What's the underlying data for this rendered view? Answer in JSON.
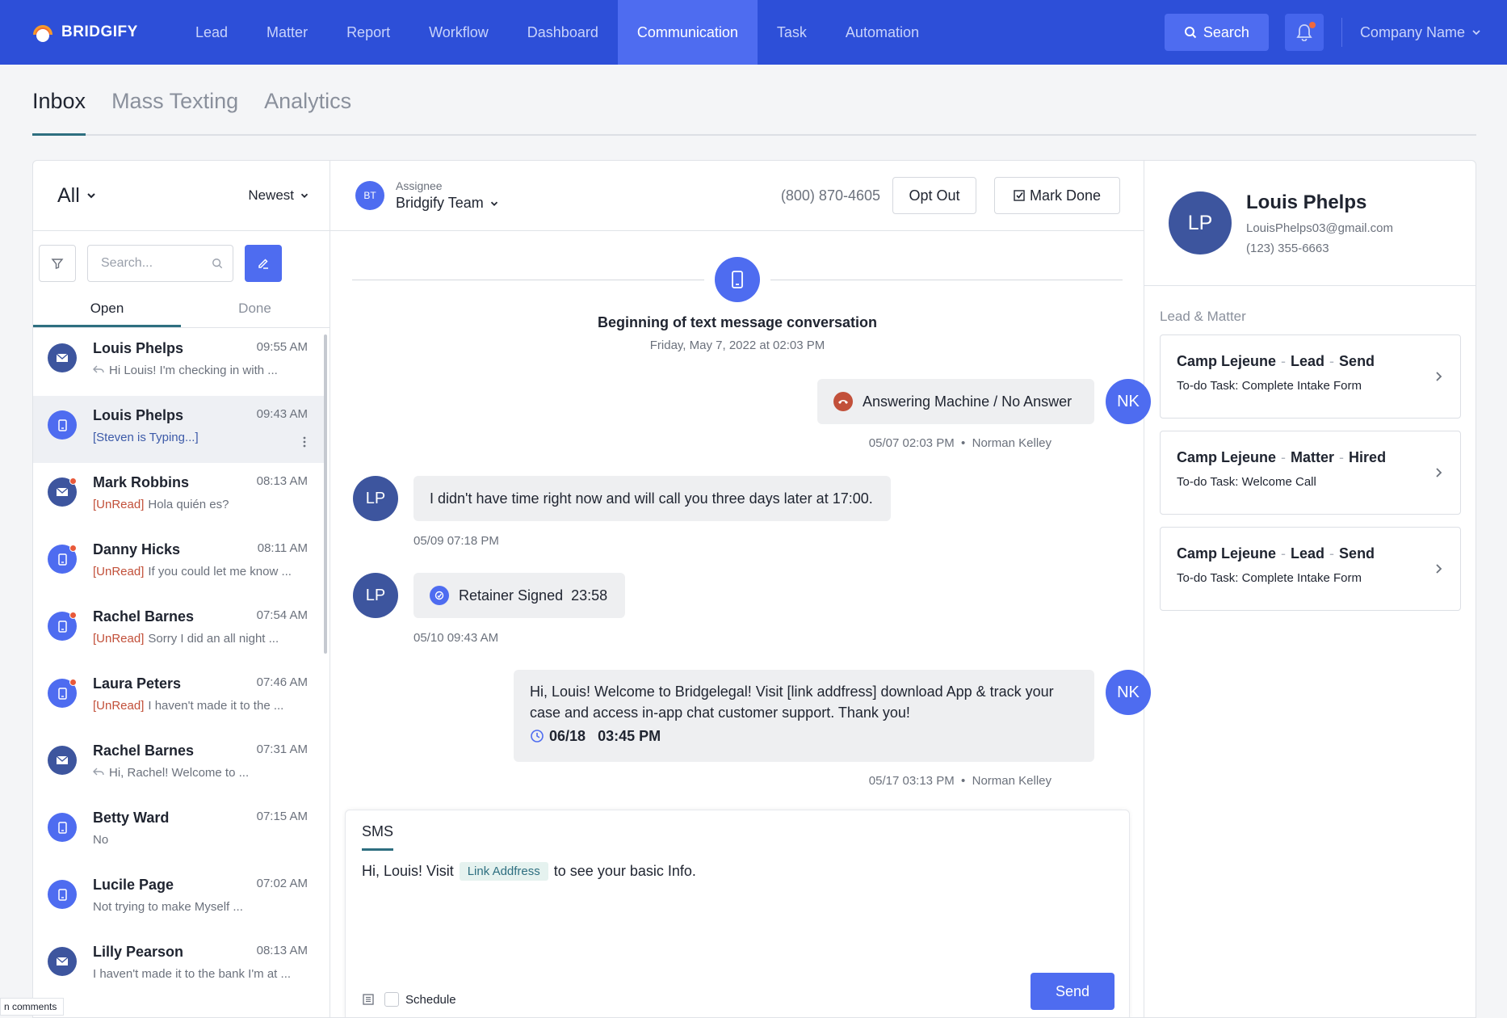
{
  "app": {
    "brand": "BRIDGIFY",
    "nav": [
      "Lead",
      "Matter",
      "Report",
      "Workflow",
      "Dashboard",
      "Communication",
      "Task",
      "Automation"
    ],
    "nav_active": "Communication",
    "search_label": "Search",
    "company": "Company Name",
    "accent": "#2d4fd8",
    "accent_light": "#4e6cf0",
    "teal": "#2e6f80",
    "unread_color": "#c2503a"
  },
  "page_tabs": [
    "Inbox",
    "Mass Texting",
    "Analytics"
  ],
  "inbox": {
    "filter": "All",
    "sort": "Newest",
    "search_placeholder": "Search...",
    "tabs": [
      "Open",
      "Done"
    ],
    "conversations": [
      {
        "name": "Louis Phelps",
        "time": "09:55 AM",
        "type": "mail",
        "tag": "",
        "preview": "Hi Louis! I'm checking in with ...",
        "replied": true,
        "unread": false,
        "selected": false
      },
      {
        "name": "Louis Phelps",
        "time": "09:43 AM",
        "type": "sms",
        "tag": "typing",
        "preview": "[Steven is Typing...]",
        "replied": false,
        "unread": false,
        "selected": true
      },
      {
        "name": "Mark Robbins",
        "time": "08:13 AM",
        "type": "mail",
        "tag": "[UnRead]",
        "preview": "Hola quién es?",
        "replied": false,
        "unread": true,
        "selected": false
      },
      {
        "name": "Danny Hicks",
        "time": "08:11 AM",
        "type": "sms",
        "tag": "[UnRead]",
        "preview": "If you could let me know ...",
        "replied": false,
        "unread": true,
        "selected": false
      },
      {
        "name": "Rachel Barnes",
        "time": "07:54 AM",
        "type": "sms",
        "tag": "[UnRead]",
        "preview": "Sorry I did an all night ...",
        "replied": false,
        "unread": true,
        "selected": false
      },
      {
        "name": "Laura Peters",
        "time": "07:46 AM",
        "type": "sms",
        "tag": "[UnRead]",
        "preview": "I haven't made it to the ...",
        "replied": false,
        "unread": true,
        "selected": false
      },
      {
        "name": "Rachel Barnes",
        "time": "07:31 AM",
        "type": "mail",
        "tag": "",
        "preview": "Hi, Rachel! Welcome to ...",
        "replied": true,
        "unread": false,
        "selected": false
      },
      {
        "name": "Betty Ward",
        "time": "07:15 AM",
        "type": "sms",
        "tag": "",
        "preview": "No",
        "replied": false,
        "unread": false,
        "selected": false
      },
      {
        "name": "Lucile Page",
        "time": "07:02 AM",
        "type": "sms",
        "tag": "",
        "preview": "Not trying to make Myself ...",
        "replied": false,
        "unread": false,
        "selected": false
      },
      {
        "name": "Lilly Pearson",
        "time": "08:13 AM",
        "type": "mail",
        "tag": "",
        "preview": "I haven't made it to the bank I'm at ...",
        "replied": false,
        "unread": false,
        "selected": false
      }
    ]
  },
  "thread": {
    "assignee_label": "Assignee",
    "assignee_initials": "BT",
    "assignee": "Bridgify Team",
    "phone": "(800) 870-4605",
    "opt_out": "Opt Out",
    "mark_done": "Mark Done",
    "start_title": "Beginning of text message conversation",
    "start_date": "Friday, May 7, 2022 at 02:03 PM",
    "messages": {
      "call": {
        "text": "Answering Machine / No Answer",
        "meta_time": "05/07 02:03 PM",
        "meta_author": "Norman Kelley",
        "initials": "NK"
      },
      "reply": {
        "text": "I didn't have time right now and will call you three days later at 17:00.",
        "meta": "05/09 07:18 PM",
        "initials": "LP"
      },
      "retainer": {
        "text": "Retainer Signed",
        "time": "23:58",
        "meta": "05/10 09:43 AM",
        "initials": "LP"
      },
      "welcome": {
        "text": "Hi, Louis! Welcome to Bridgelegal! Visit [link addfress] download App & track your case and access in-app chat customer support. Thank you!",
        "sched_date": "06/18",
        "sched_time": "03:45 PM",
        "meta_time": "05/17 03:13 PM",
        "meta_author": "Norman Kelley",
        "initials": "NK"
      }
    }
  },
  "composer": {
    "tab": "SMS",
    "text_before": "Hi, Louis! Visit",
    "link_chip": "Link Addfress",
    "text_after": "to see your basic Info.",
    "schedule": "Schedule",
    "send": "Send"
  },
  "contact": {
    "initials": "LP",
    "name": "Louis Phelps",
    "email": "LouisPhelps03@gmail.com",
    "phone": "(123) 355-6663",
    "section_title": "Lead & Matter",
    "cards": [
      {
        "parts": [
          "Camp Lejeune",
          "Lead",
          "Send"
        ],
        "task": "To-do Task: Complete Intake Form"
      },
      {
        "parts": [
          "Camp Lejeune",
          "Matter",
          "Hired"
        ],
        "task": "To-do Task: Welcome Call"
      },
      {
        "parts": [
          "Camp Lejeune",
          "Lead",
          "Send"
        ],
        "task": "To-do Task: Complete Intake Form"
      }
    ]
  },
  "corner_tip": "n comments"
}
